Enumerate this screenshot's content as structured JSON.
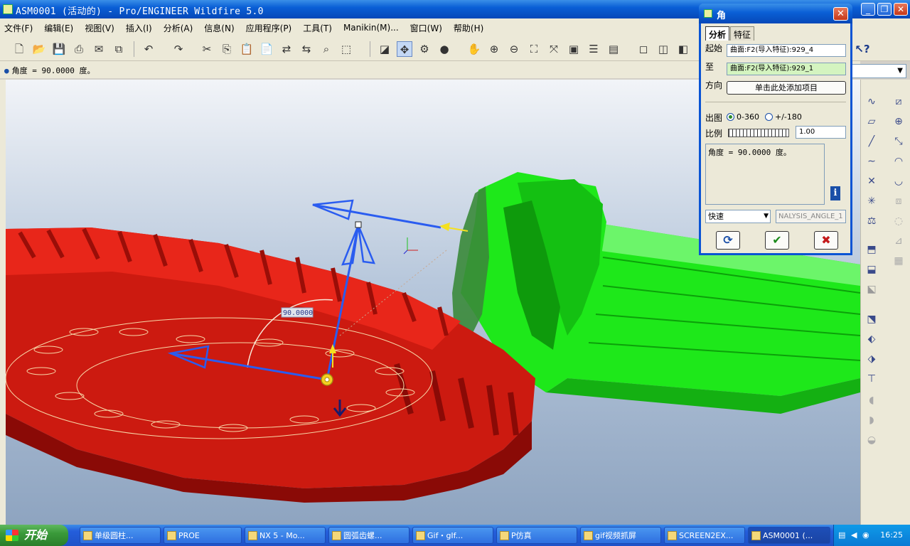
{
  "window": {
    "title": "ASM0001 (活动的) - Pro/ENGINEER Wildfire 5.0",
    "minimize_label": "_",
    "restore_label": "❐",
    "close_label": "✕"
  },
  "menu": [
    {
      "label": "文件(F)"
    },
    {
      "label": "编辑(E)"
    },
    {
      "label": "视图(V)"
    },
    {
      "label": "插入(I)"
    },
    {
      "label": "分析(A)"
    },
    {
      "label": "信息(N)"
    },
    {
      "label": "应用程序(P)"
    },
    {
      "label": "工具(T)"
    },
    {
      "label": "Manikin(M)..."
    },
    {
      "label": "窗口(W)"
    },
    {
      "label": "帮助(H)"
    }
  ],
  "message_line": "角度 = 90.0000 度。",
  "viewport": {
    "angle_label": "90.0000",
    "colors": {
      "gear_red": "#cc1a10",
      "pinion_green": "#1ee81a",
      "vector_blue": "#2a5cf0",
      "vector_yellow": "#f4e020"
    }
  },
  "dialog": {
    "title": "角",
    "close_label": "✕",
    "tabs": [
      {
        "label": "分析"
      },
      {
        "label": "特征"
      }
    ],
    "from_label": "起始",
    "from_value": "曲面:F2(导入特征):929_4",
    "to_label": "至",
    "to_value": "曲面:F2(导入特征):929_1",
    "direction_label": "方向",
    "direction_button": "单击此处添加项目",
    "output_label": "出图",
    "option_0_360": "0-360",
    "option_pm180": "+/-180",
    "scale_label": "比例",
    "scale_value": "1.00",
    "result_text": "角度 = 90.0000 度。",
    "info_label": "i",
    "mode_select": "快速",
    "analysis_name": "NALYSIS_ANGLE_1",
    "repeat_icon": "refresh-icon",
    "ok_icon": "checkmark-icon",
    "cancel_icon": "x-icon"
  },
  "taskbar": {
    "start_label": "开始",
    "tasks": [
      {
        "label": "单级圆柱..."
      },
      {
        "label": "PROE"
      },
      {
        "label": "NX 5 - Mo..."
      },
      {
        "label": "圆弧齿螺..."
      },
      {
        "label": "Gif・gIf..."
      },
      {
        "label": "P仿真"
      },
      {
        "label": "gif视频抓屏"
      },
      {
        "label": "SCREEN2EX..."
      },
      {
        "label": "ASM0001 (..."
      }
    ],
    "clock": "16:25"
  }
}
